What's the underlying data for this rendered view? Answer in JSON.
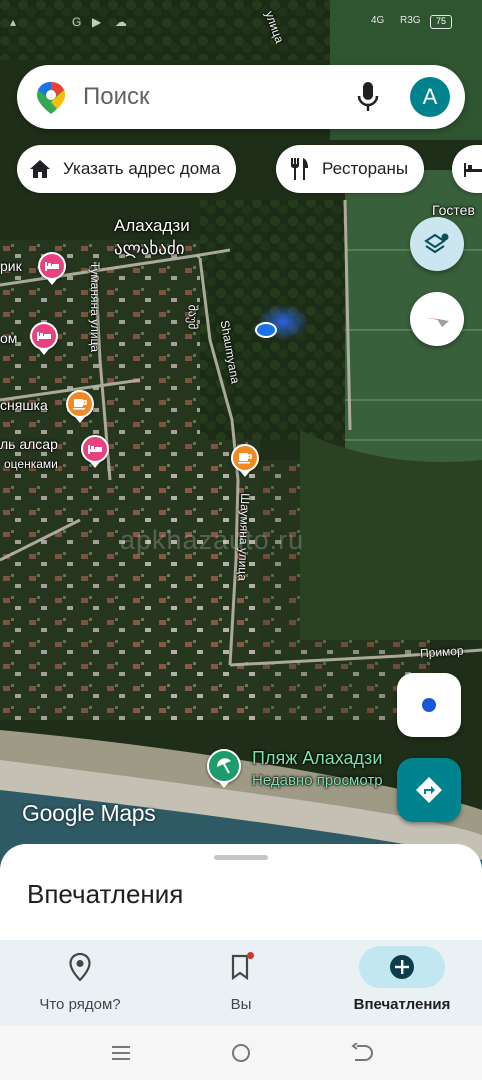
{
  "status_bar": {
    "network": "4G",
    "signal_tag": "R3G",
    "battery": "75"
  },
  "search": {
    "placeholder": "Поиск",
    "avatar_letter": "A"
  },
  "chips": [
    {
      "label": "Указать адрес дома",
      "icon": "home-icon"
    },
    {
      "label": "Рестораны",
      "icon": "restaurant-icon"
    },
    {
      "label": "",
      "icon": "hotel-icon"
    }
  ],
  "map": {
    "labels": {
      "town_ru": "Алахадзи",
      "town_ka": "ალახაძი",
      "top_right": "Гостев",
      "pin1": "рик",
      "pin2": "ом",
      "pin3": "сняшка",
      "pin4_line1": "ль алсар",
      "pin4_line2": "оценками",
      "beach_name": "Пляж Алахадзи",
      "beach_sub": "Недавно просмотр"
    },
    "streets": {
      "tumanyan": "Туманяна улица",
      "shaumyana_upper": "Shaumyana",
      "shaumyana_upper_ka": "შაუმ",
      "shaumyana_lower": "Шаумяна улица",
      "primorsk": "Примор",
      "top_street": "улица"
    },
    "logo": "Google Maps",
    "watermark": "apkhazauto.ru",
    "colors": {
      "hotel_pin": "#e8417f",
      "cafe_pin": "#f08a24",
      "beach_pin": "#1c9c6b",
      "location_dot": "#1a73e8"
    }
  },
  "bottom_sheet": {
    "title": "Впечатления"
  },
  "nav": [
    {
      "label": "Что рядом?",
      "icon": "location-pin-icon"
    },
    {
      "label": "Вы",
      "icon": "bookmark-icon",
      "badge": true
    },
    {
      "label": "Впечатления",
      "icon": "add-circle-icon",
      "active": true
    }
  ],
  "system_nav": {
    "recents": "menu-icon",
    "home": "home-circle-icon",
    "back": "back-icon"
  }
}
